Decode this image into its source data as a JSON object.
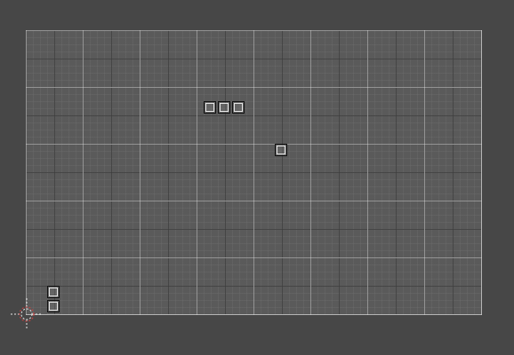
{
  "editor": {
    "viewport": "tilemap-grid-view",
    "colors": {
      "background": "#474747",
      "canvas": "#5a5a5a",
      "major_grid": "#d2d2d2",
      "minor_grid": "#3c3c3c",
      "origin_marker": "#c04040"
    },
    "tiles": [
      {
        "group": "row-of-three",
        "count": 3
      },
      {
        "group": "single",
        "count": 1
      },
      {
        "group": "column-of-two",
        "count": 2
      }
    ],
    "origin_icon": "origin-crosshair-icon"
  }
}
